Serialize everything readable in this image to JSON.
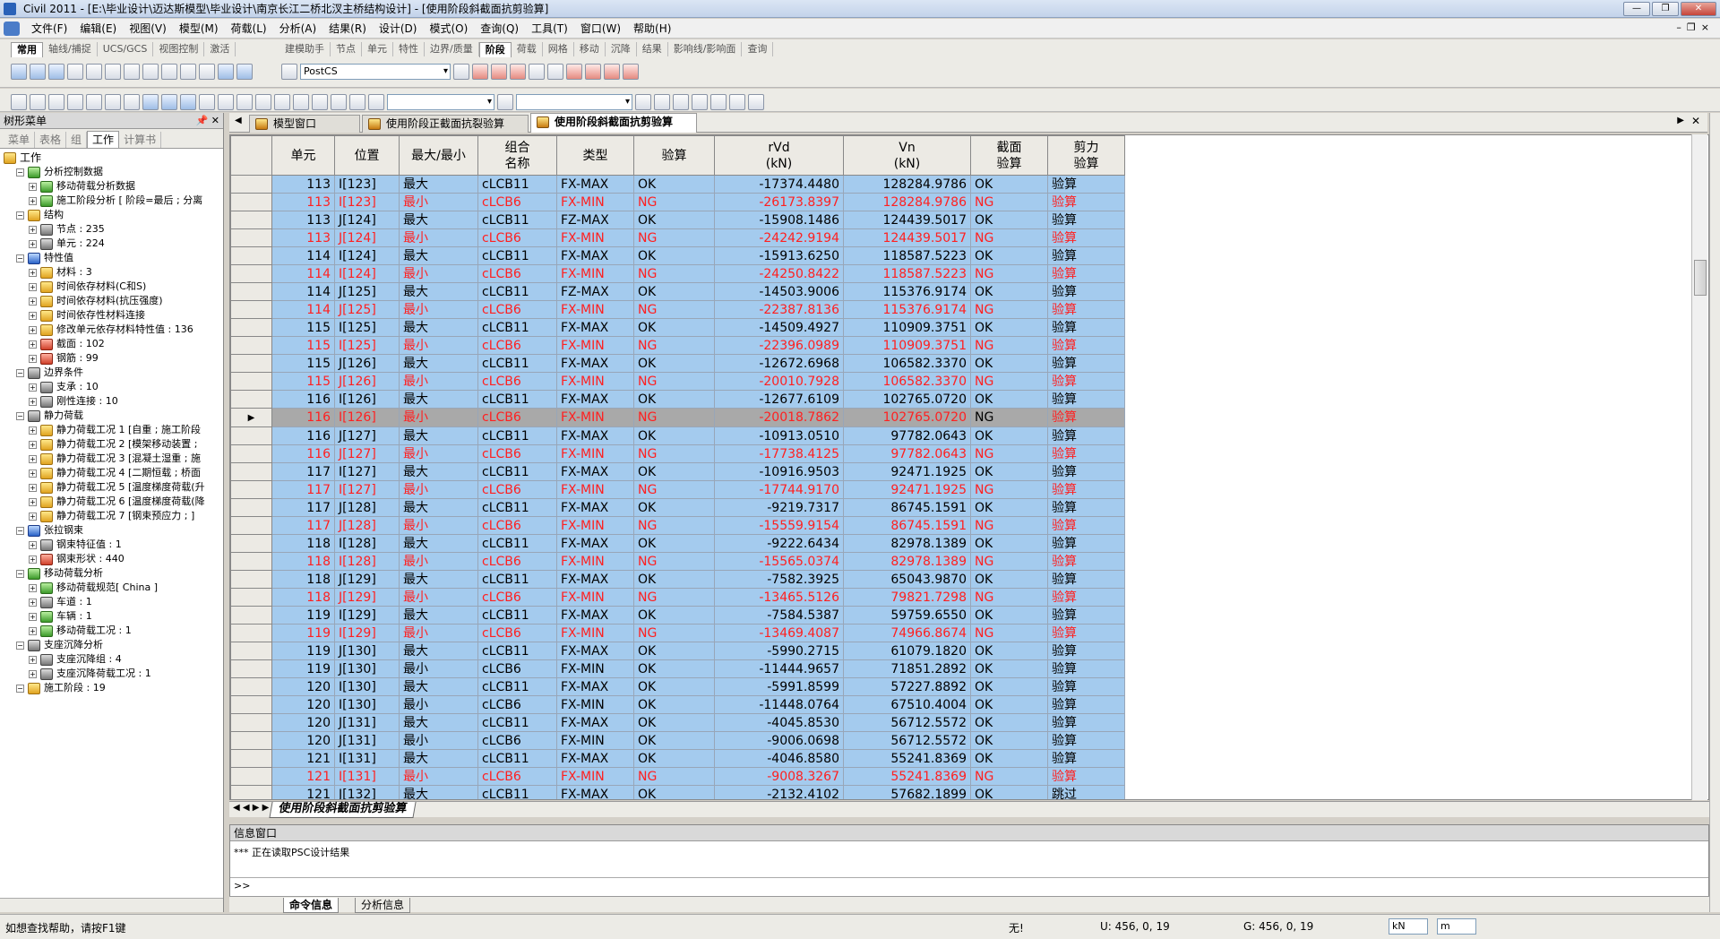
{
  "window": {
    "title": "Civil 2011 - [E:\\毕业设计\\迈达斯模型\\毕业设计\\南京长江二桥北汊主桥结构设计] - [使用阶段斜截面抗剪验算]"
  },
  "menu": [
    "文件(F)",
    "编辑(E)",
    "视图(V)",
    "模型(M)",
    "荷载(L)",
    "分析(A)",
    "结果(R)",
    "设计(D)",
    "模式(O)",
    "查询(Q)",
    "工具(T)",
    "窗口(W)",
    "帮助(H)"
  ],
  "ribbon_tabs_left": [
    "常用",
    "轴线/捕捉",
    "UCS/GCS",
    "视图控制",
    "激活"
  ],
  "ribbon_tabs_right": [
    "建模助手",
    "节点",
    "单元",
    "特性",
    "边界/质量",
    "阶段",
    "荷载",
    "网格",
    "移动",
    "沉降",
    "结果",
    "影响线/影响面",
    "查询"
  ],
  "stage_combo": "PostCS",
  "tree": {
    "header": "树形菜单",
    "tabs": [
      "菜单",
      "表格",
      "组",
      "工作",
      "计算书"
    ],
    "items": [
      {
        "lvl": 0,
        "label": "工作",
        "icon": "y"
      },
      {
        "lvl": 1,
        "label": "分析控制数据",
        "icon": "g"
      },
      {
        "lvl": 2,
        "label": "移动荷载分析数据",
        "icon": "g"
      },
      {
        "lvl": 2,
        "label": "施工阶段分析 [ 阶段=最后 ; 分离",
        "icon": "g"
      },
      {
        "lvl": 1,
        "label": "结构",
        "icon": "y"
      },
      {
        "lvl": 2,
        "label": "节点 : 235",
        "icon": "k"
      },
      {
        "lvl": 2,
        "label": "单元 : 224",
        "icon": "k"
      },
      {
        "lvl": 1,
        "label": "特性值",
        "icon": "bl"
      },
      {
        "lvl": 2,
        "label": "材料 : 3",
        "icon": "y"
      },
      {
        "lvl": 2,
        "label": "时间依存材料(C和S)",
        "icon": "y"
      },
      {
        "lvl": 2,
        "label": "时间依存材料(抗压强度)",
        "icon": "y"
      },
      {
        "lvl": 2,
        "label": "时间依存性材料连接",
        "icon": "y"
      },
      {
        "lvl": 2,
        "label": "修改单元依存材料特性值 : 136",
        "icon": "y"
      },
      {
        "lvl": 2,
        "label": "截面 : 102",
        "icon": "r"
      },
      {
        "lvl": 2,
        "label": "钢筋 : 99",
        "icon": "r"
      },
      {
        "lvl": 1,
        "label": "边界条件",
        "icon": "k"
      },
      {
        "lvl": 2,
        "label": "支承 : 10",
        "icon": "k"
      },
      {
        "lvl": 2,
        "label": "刚性连接 : 10",
        "icon": "k"
      },
      {
        "lvl": 1,
        "label": "静力荷载",
        "icon": "k"
      },
      {
        "lvl": 2,
        "label": "静力荷载工况 1 [自重 ; 施工阶段",
        "icon": "y"
      },
      {
        "lvl": 2,
        "label": "静力荷载工况 2 [模架移动装置 ;",
        "icon": "y"
      },
      {
        "lvl": 2,
        "label": "静力荷载工况 3 [混凝土湿重 ; 施",
        "icon": "y"
      },
      {
        "lvl": 2,
        "label": "静力荷载工况 4 [二期恒载 ; 桥面",
        "icon": "y"
      },
      {
        "lvl": 2,
        "label": "静力荷载工况 5 [温度梯度荷载(升",
        "icon": "y"
      },
      {
        "lvl": 2,
        "label": "静力荷载工况 6 [温度梯度荷载(降",
        "icon": "y"
      },
      {
        "lvl": 2,
        "label": "静力荷载工况 7 [钢束预应力 ; ]",
        "icon": "y"
      },
      {
        "lvl": 1,
        "label": "张拉钢束",
        "icon": "bl"
      },
      {
        "lvl": 2,
        "label": "钢束特征值 : 1",
        "icon": "k"
      },
      {
        "lvl": 2,
        "label": "钢束形状 : 440",
        "icon": "r"
      },
      {
        "lvl": 1,
        "label": "移动荷载分析",
        "icon": "g"
      },
      {
        "lvl": 2,
        "label": "移动荷载规范[ China ]",
        "icon": "g"
      },
      {
        "lvl": 2,
        "label": "车道 : 1",
        "icon": "k"
      },
      {
        "lvl": 2,
        "label": "车辆 : 1",
        "icon": "g"
      },
      {
        "lvl": 2,
        "label": "移动荷载工况 : 1",
        "icon": "g"
      },
      {
        "lvl": 1,
        "label": "支座沉降分析",
        "icon": "k"
      },
      {
        "lvl": 2,
        "label": "支座沉降组 : 4",
        "icon": "k"
      },
      {
        "lvl": 2,
        "label": "支座沉降荷载工况 : 1",
        "icon": "k"
      },
      {
        "lvl": 1,
        "label": "施工阶段 : 19",
        "icon": "y"
      }
    ]
  },
  "doc_tabs": [
    "模型窗口",
    "使用阶段正截面抗裂验算",
    "使用阶段斜截面抗剪验算"
  ],
  "table": {
    "headers": [
      "单元",
      "位置",
      "最大/最小",
      "组合\n名称",
      "类型",
      "验算",
      "rVd\n(kN)",
      "Vn\n(kN)",
      "截面\n验算",
      "剪力\n验算"
    ],
    "rows": [
      [
        "113",
        "I[123]",
        "最大",
        "cLCB11",
        "FX-MAX",
        "OK",
        "-17374.4480",
        "128284.9786",
        "OK",
        "验算"
      ],
      [
        "113",
        "I[123]",
        "最小",
        "cLCB6",
        "FX-MIN",
        "NG",
        "-26173.8397",
        "128284.9786",
        "NG",
        "验算"
      ],
      [
        "113",
        "J[124]",
        "最大",
        "cLCB11",
        "FZ-MAX",
        "OK",
        "-15908.1486",
        "124439.5017",
        "OK",
        "验算"
      ],
      [
        "113",
        "J[124]",
        "最小",
        "cLCB6",
        "FX-MIN",
        "NG",
        "-24242.9194",
        "124439.5017",
        "NG",
        "验算"
      ],
      [
        "114",
        "I[124]",
        "最大",
        "cLCB11",
        "FX-MAX",
        "OK",
        "-15913.6250",
        "118587.5223",
        "OK",
        "验算"
      ],
      [
        "114",
        "I[124]",
        "最小",
        "cLCB6",
        "FX-MIN",
        "NG",
        "-24250.8422",
        "118587.5223",
        "NG",
        "验算"
      ],
      [
        "114",
        "J[125]",
        "最大",
        "cLCB11",
        "FZ-MAX",
        "OK",
        "-14503.9006",
        "115376.9174",
        "OK",
        "验算"
      ],
      [
        "114",
        "J[125]",
        "最小",
        "cLCB6",
        "FX-MIN",
        "NG",
        "-22387.8136",
        "115376.9174",
        "NG",
        "验算"
      ],
      [
        "115",
        "I[125]",
        "最大",
        "cLCB11",
        "FX-MAX",
        "OK",
        "-14509.4927",
        "110909.3751",
        "OK",
        "验算"
      ],
      [
        "115",
        "I[125]",
        "最小",
        "cLCB6",
        "FX-MIN",
        "NG",
        "-22396.0989",
        "110909.3751",
        "NG",
        "验算"
      ],
      [
        "115",
        "J[126]",
        "最大",
        "cLCB11",
        "FX-MAX",
        "OK",
        "-12672.6968",
        "106582.3370",
        "OK",
        "验算"
      ],
      [
        "115",
        "J[126]",
        "最小",
        "cLCB6",
        "FX-MIN",
        "NG",
        "-20010.7928",
        "106582.3370",
        "NG",
        "验算"
      ],
      [
        "116",
        "I[126]",
        "最大",
        "cLCB11",
        "FX-MAX",
        "OK",
        "-12677.6109",
        "102765.0720",
        "OK",
        "验算"
      ],
      [
        "116",
        "I[126]",
        "最小",
        "cLCB6",
        "FX-MIN",
        "NG",
        "-20018.7862",
        "102765.0720",
        "NG",
        "验算"
      ],
      [
        "116",
        "J[127]",
        "最大",
        "cLCB11",
        "FX-MAX",
        "OK",
        "-10913.0510",
        "97782.0643",
        "OK",
        "验算"
      ],
      [
        "116",
        "J[127]",
        "最小",
        "cLCB6",
        "FX-MIN",
        "NG",
        "-17738.4125",
        "97782.0643",
        "NG",
        "验算"
      ],
      [
        "117",
        "I[127]",
        "最大",
        "cLCB11",
        "FX-MAX",
        "OK",
        "-10916.9503",
        "92471.1925",
        "OK",
        "验算"
      ],
      [
        "117",
        "I[127]",
        "最小",
        "cLCB6",
        "FX-MIN",
        "NG",
        "-17744.9170",
        "92471.1925",
        "NG",
        "验算"
      ],
      [
        "117",
        "J[128]",
        "最大",
        "cLCB11",
        "FX-MAX",
        "OK",
        "-9219.7317",
        "86745.1591",
        "OK",
        "验算"
      ],
      [
        "117",
        "J[128]",
        "最小",
        "cLCB6",
        "FX-MIN",
        "NG",
        "-15559.9154",
        "86745.1591",
        "NG",
        "验算"
      ],
      [
        "118",
        "I[128]",
        "最大",
        "cLCB11",
        "FX-MAX",
        "OK",
        "-9222.6434",
        "82978.1389",
        "OK",
        "验算"
      ],
      [
        "118",
        "I[128]",
        "最小",
        "cLCB6",
        "FX-MIN",
        "NG",
        "-15565.0374",
        "82978.1389",
        "NG",
        "验算"
      ],
      [
        "118",
        "J[129]",
        "最大",
        "cLCB11",
        "FX-MAX",
        "OK",
        "-7582.3925",
        "65043.9870",
        "OK",
        "验算"
      ],
      [
        "118",
        "J[129]",
        "最小",
        "cLCB6",
        "FX-MIN",
        "NG",
        "-13465.5126",
        "79821.7298",
        "NG",
        "验算"
      ],
      [
        "119",
        "I[129]",
        "最大",
        "cLCB11",
        "FX-MAX",
        "OK",
        "-7584.5387",
        "59759.6550",
        "OK",
        "验算"
      ],
      [
        "119",
        "I[129]",
        "最小",
        "cLCB6",
        "FX-MIN",
        "NG",
        "-13469.4087",
        "74966.8674",
        "NG",
        "验算"
      ],
      [
        "119",
        "J[130]",
        "最大",
        "cLCB11",
        "FX-MAX",
        "OK",
        "-5990.2715",
        "61079.1820",
        "OK",
        "验算"
      ],
      [
        "119",
        "J[130]",
        "最小",
        "cLCB6",
        "FX-MIN",
        "OK",
        "-11444.9657",
        "71851.2892",
        "OK",
        "验算"
      ],
      [
        "120",
        "I[130]",
        "最大",
        "cLCB11",
        "FX-MAX",
        "OK",
        "-5991.8599",
        "57227.8892",
        "OK",
        "验算"
      ],
      [
        "120",
        "I[130]",
        "最小",
        "cLCB6",
        "FX-MIN",
        "OK",
        "-11448.0764",
        "67510.4004",
        "OK",
        "验算"
      ],
      [
        "120",
        "J[131]",
        "最大",
        "cLCB11",
        "FX-MAX",
        "OK",
        "-4045.8530",
        "56712.5572",
        "OK",
        "验算"
      ],
      [
        "120",
        "J[131]",
        "最小",
        "cLCB6",
        "FX-MIN",
        "OK",
        "-9006.0698",
        "56712.5572",
        "OK",
        "验算"
      ],
      [
        "121",
        "I[131]",
        "最大",
        "cLCB11",
        "FX-MAX",
        "OK",
        "-4046.8580",
        "55241.8369",
        "OK",
        "验算"
      ],
      [
        "121",
        "I[131]",
        "最小",
        "cLCB6",
        "FX-MIN",
        "NG",
        "-9008.3267",
        "55241.8369",
        "NG",
        "验算"
      ],
      [
        "121",
        "J[132]",
        "最大",
        "cLCB11",
        "FX-MAX",
        "OK",
        "-2132.4102",
        "57682.1899",
        "OK",
        "跳过"
      ]
    ],
    "selected_row": 13,
    "selected_arrow": "▶"
  },
  "sheet_tab": "使用阶段斜截面抗剪验算",
  "info": {
    "header": "信息窗口",
    "text": "*** 正在读取PSC设计结果",
    "prompt": ">>",
    "tabs": [
      "命令信息",
      "分析信息"
    ]
  },
  "status": {
    "help": "如想查找帮助，请按F1键",
    "none": "无!",
    "u": "U: 456, 0, 19",
    "g": "G: 456, 0, 19",
    "unit_force": "kN",
    "unit_len": "m"
  },
  "colors": {
    "row_bg": "#a4cbee",
    "ng_text": "#ff2020",
    "selected_bg": "#a9a9a9"
  }
}
